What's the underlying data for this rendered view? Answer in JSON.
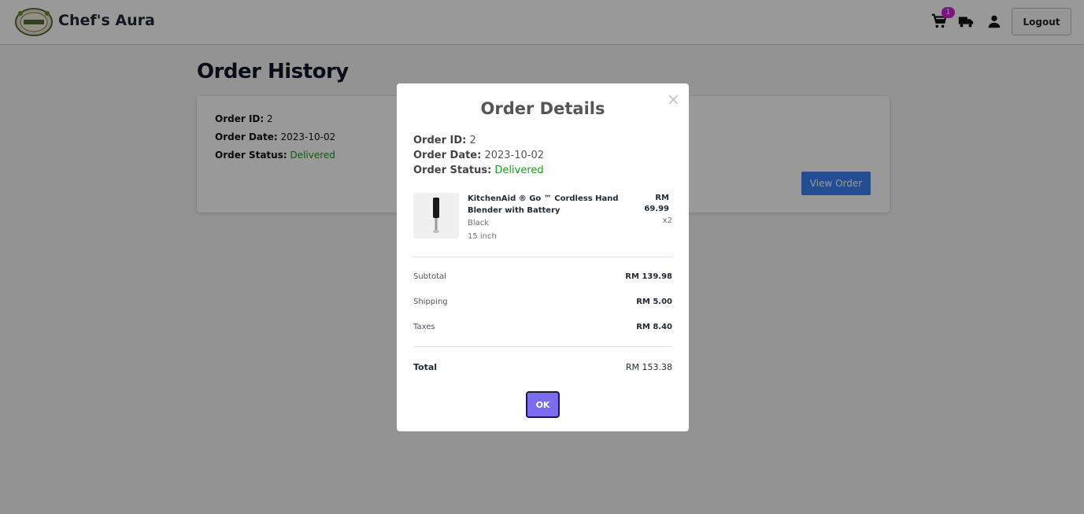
{
  "header": {
    "brand": "Chef's Aura",
    "logo_icon": "chefs-aura-logo",
    "cart_badge": "1",
    "logout_label": "Logout"
  },
  "page": {
    "title": "Order History",
    "order_card": {
      "order_id_label": "Order ID:",
      "order_id": "2",
      "order_date_label": "Order Date:",
      "order_date": "2023-10-02",
      "order_status_label": "Order Status:",
      "order_status": "Delivered",
      "view_button": "View Order"
    }
  },
  "modal": {
    "title": "Order Details",
    "close": "×",
    "order_id_label": "Order ID:",
    "order_id": "2",
    "order_date_label": "Order Date:",
    "order_date": "2023-10-02",
    "order_status_label": "Order Status:",
    "order_status": "Delivered",
    "item": {
      "name": "KitchenAid ® Go ™ Cordless Hand Blender with Battery",
      "color": "Black",
      "size": "15 inch",
      "price_currency": "RM",
      "price": "69.99",
      "qty": "x2"
    },
    "summary": {
      "subtotal_label": "Subtotal",
      "subtotal": "RM 139.98",
      "shipping_label": "Shipping",
      "shipping": "RM 5.00",
      "taxes_label": "Taxes",
      "taxes": "RM 8.40",
      "total_label": "Total",
      "total": "RM 153.38"
    },
    "ok_label": "OK"
  },
  "colors": {
    "status_green": "#1a9b1a",
    "view_button": "#3b82f6",
    "ok_button": "#7c6cf0",
    "cart_badge": "#d21fd2"
  }
}
